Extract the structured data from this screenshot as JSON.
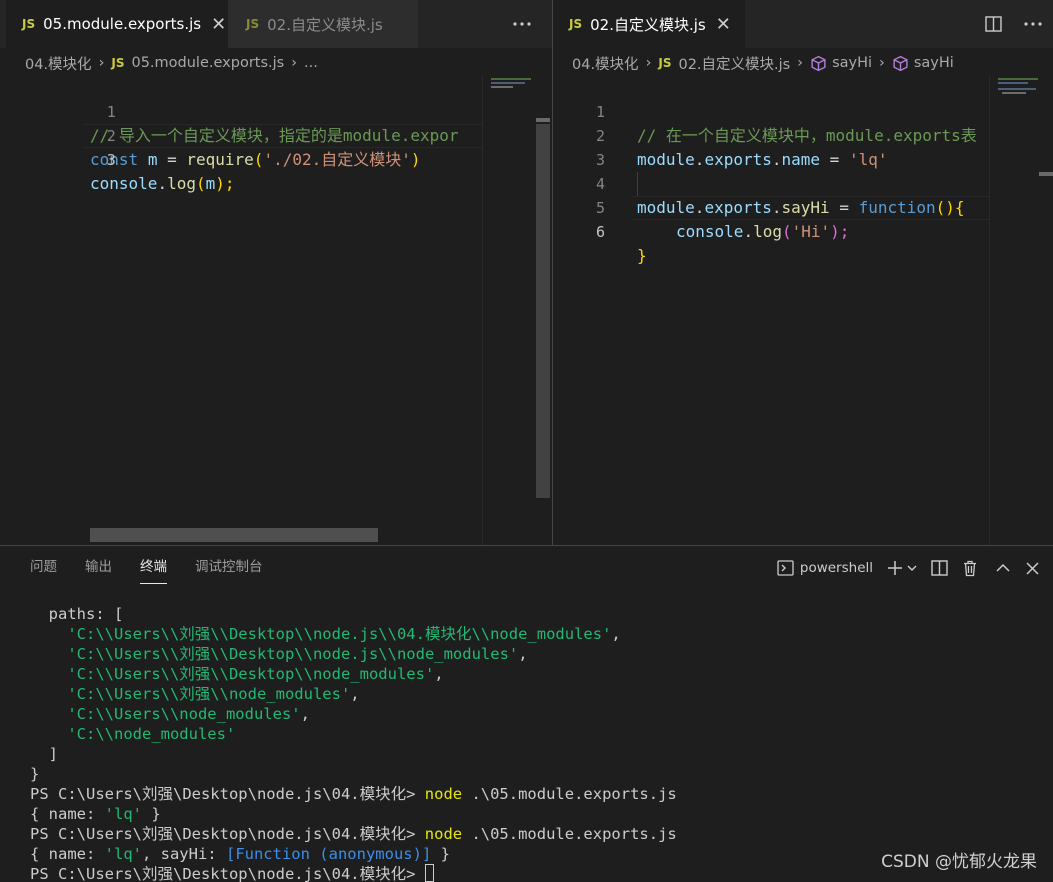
{
  "left_group": {
    "tabs": [
      {
        "badge": "JS",
        "label": "05.module.exports.js",
        "close": "✕"
      },
      {
        "badge": "JS",
        "label": "02.自定义模块.js"
      }
    ],
    "more_icon": "more-actions-icon",
    "breadcrumb": {
      "folder": "04.模块化",
      "badge": "JS",
      "file": "05.module.exports.js",
      "ellipsis": "..."
    },
    "lines": [
      {
        "num": "1"
      },
      {
        "num": "2"
      },
      {
        "num": "3"
      }
    ],
    "code": {
      "l1": "// 导入一个自定义模块，指定的是module.expor",
      "l2_kw": "const",
      "l2_var": "m",
      "l2_eq": " = ",
      "l2_fn": "require",
      "l2_open": "(",
      "l2_str": "'./02.自定义模块'",
      "l2_close": ")",
      "l3_obj": "console",
      "l3_dot": ".",
      "l3_fn": "log",
      "l3_open": "(",
      "l3_arg": "m",
      "l3_close": ");"
    }
  },
  "right_group": {
    "tab": {
      "badge": "JS",
      "label": "02.自定义模块.js",
      "close": "✕"
    },
    "breadcrumb": {
      "folder": "04.模块化",
      "badge": "JS",
      "file": "02.自定义模块.js",
      "sym1": "sayHi",
      "sym2": "sayHi"
    },
    "lines": [
      {
        "num": "1"
      },
      {
        "num": "2"
      },
      {
        "num": "3"
      },
      {
        "num": "4"
      },
      {
        "num": "5"
      },
      {
        "num": "6"
      }
    ],
    "code": {
      "l1": "// 在一个自定义模块中，module.exports表",
      "l2_obj": "module",
      "l2_prop1": "exports",
      "l2_prop2": "name",
      "l2_eq": " = ",
      "l2_str": "'lq'",
      "l4_obj": "module",
      "l4_prop1": "exports",
      "l4_fn": "sayHi",
      "l4_eq": " = ",
      "l4_kw": "function",
      "l4_parens": "()",
      "l4_brace": "{",
      "l5_obj": "console",
      "l5_fn": "log",
      "l5_open": "(",
      "l5_str": "'Hi'",
      "l5_close": ");",
      "l6_brace": "}"
    }
  },
  "panel": {
    "tabs": [
      "问题",
      "输出",
      "终端",
      "调试控制台"
    ],
    "active_tab": "终端",
    "shell": "powershell",
    "terminal": {
      "paths_label": "  paths: [",
      "paths": [
        "'C:\\\\Users\\\\刘强\\\\Desktop\\\\node.js\\\\04.模块化\\\\node_modules'",
        "'C:\\\\Users\\\\刘强\\\\Desktop\\\\node.js\\\\node_modules'",
        "'C:\\\\Users\\\\刘强\\\\Desktop\\\\node_modules'",
        "'C:\\\\Users\\\\刘强\\\\node_modules'",
        "'C:\\\\Users\\\\node_modules'",
        "'C:\\\\node_modules'"
      ],
      "path_seps": [
        ",",
        ",",
        ",",
        ",",
        ",",
        ""
      ],
      "close_bracket": "  ]",
      "close_brace": "}",
      "prompt": "PS C:\\Users\\刘强\\Desktop\\node.js\\04.模块化> ",
      "cmd_node": "node",
      "cmd_arg": " .\\05.module.exports.js",
      "out1_a": "{ name: ",
      "out1_str": "'lq'",
      "out1_b": " }",
      "out2_a": "{ name: ",
      "out2_str": "'lq'",
      "out2_b": ", sayHi: ",
      "out2_fn": "[Function (anonymous)]",
      "out2_c": " }"
    }
  },
  "watermark": "CSDN @忧郁火龙果",
  "colors": {
    "editor_bg": "#1e1e1e",
    "tabbar_bg": "#252526",
    "js_badge": "#cbcb41",
    "comment": "#6a9955",
    "keyword": "#569cd6",
    "string": "#ce9178",
    "terminal_string": "#23b873",
    "terminal_command": "#e5e510"
  }
}
